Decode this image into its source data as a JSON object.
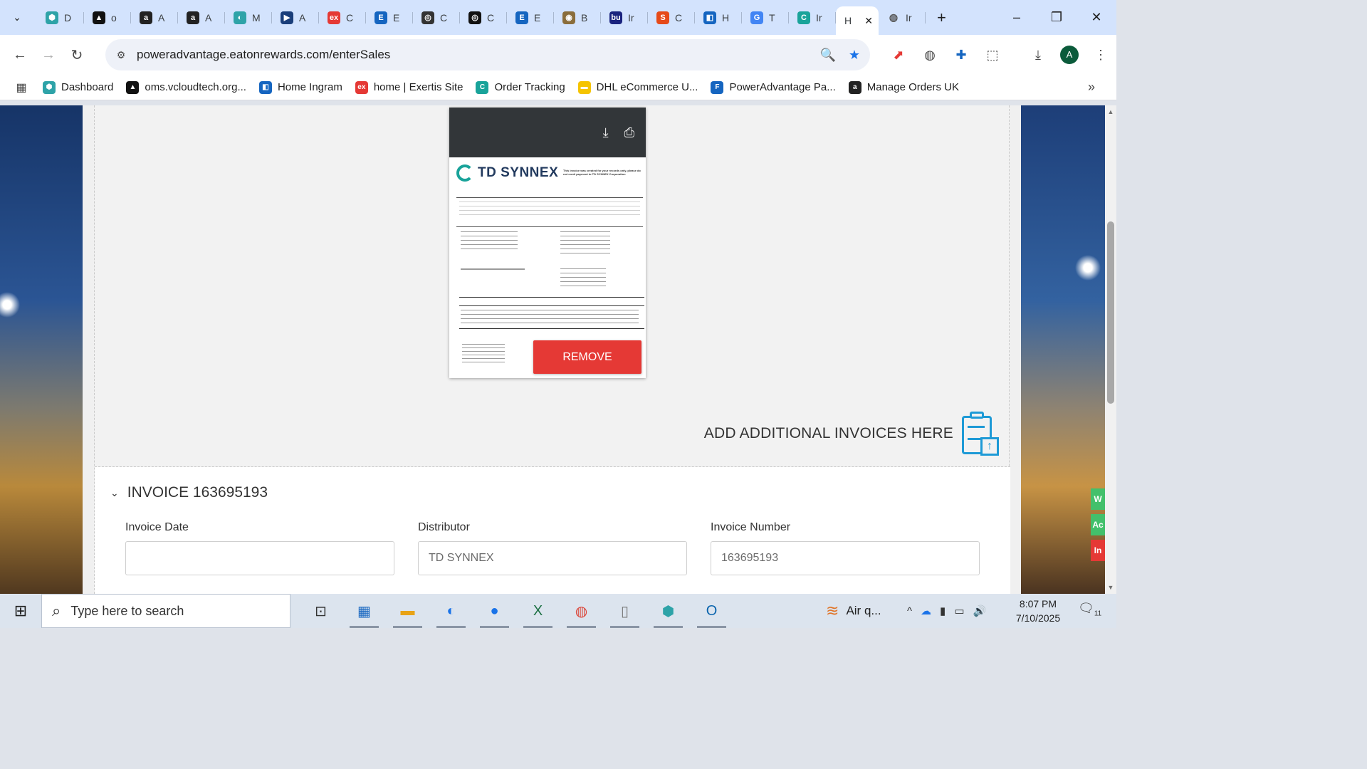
{
  "browser": {
    "tabs": [
      {
        "letter": "D",
        "color": "#2ea3a8",
        "glyph": "⬢"
      },
      {
        "letter": "o",
        "color": "#111111",
        "glyph": "▲"
      },
      {
        "letter": "A",
        "color": "#222222",
        "glyph": "a"
      },
      {
        "letter": "A",
        "color": "#222222",
        "glyph": "a"
      },
      {
        "letter": "M",
        "color": "#2ea3a8",
        "glyph": "◐"
      },
      {
        "letter": "A",
        "color": "#1a3e7a",
        "glyph": "▶"
      },
      {
        "letter": "C",
        "color": "#e53935",
        "glyph": "ex"
      },
      {
        "letter": "E",
        "color": "#1565c0",
        "glyph": "E"
      },
      {
        "letter": "C",
        "color": "#333333",
        "glyph": "◎"
      },
      {
        "letter": "C",
        "color": "#111111",
        "glyph": "◎"
      },
      {
        "letter": "E",
        "color": "#1565c0",
        "glyph": "E"
      },
      {
        "letter": "B",
        "color": "#8a6d3b",
        "glyph": "◉"
      },
      {
        "letter": "Ir",
        "color": "#1a237e",
        "glyph": "bu"
      },
      {
        "letter": "C",
        "color": "#e64a19",
        "glyph": "S"
      },
      {
        "letter": "H",
        "color": "#1565c0",
        "glyph": "◧"
      },
      {
        "letter": "T",
        "color": "#4285f4",
        "glyph": "G"
      },
      {
        "letter": "Ir",
        "color": "#19a39a",
        "glyph": "C"
      }
    ],
    "active_tab": {
      "letter": "H",
      "close": "✕"
    },
    "last_tab": {
      "letter": "Ir",
      "glyph": "◍"
    },
    "new_tab": "+",
    "window_controls": {
      "minimize": "–",
      "restore": "❐",
      "close": "✕"
    },
    "nav": {
      "back": "←",
      "forward": "→",
      "reload": "↻",
      "site_info": "⚙"
    },
    "url": "poweradvantage.eatonrewards.com/enterSales",
    "omni_icons": {
      "zoom": "🔍",
      "star": "★"
    },
    "extensions": [
      "⬈",
      "◍",
      "✚",
      "⬚",
      "⤓"
    ],
    "profile_initial": "A",
    "menu": "⋮",
    "tab_menu": "⌄",
    "bookmarks_apps": "▦",
    "bookmarks": [
      {
        "label": "Dashboard",
        "color": "#2ea3a8",
        "glyph": "⬢"
      },
      {
        "label": "oms.vcloudtech.org...",
        "color": "#111111",
        "glyph": "▲"
      },
      {
        "label": "Home Ingram",
        "color": "#1565c0",
        "glyph": "◧"
      },
      {
        "label": "home | Exertis Site",
        "color": "#e53935",
        "glyph": "ex"
      },
      {
        "label": "Order Tracking",
        "color": "#19a39a",
        "glyph": "C"
      },
      {
        "label": "DHL eCommerce U...",
        "color": "#f5c400",
        "glyph": "▬"
      },
      {
        "label": "PowerAdvantage Pa...",
        "color": "#1565c0",
        "glyph": "F"
      },
      {
        "label": "Manage Orders UK",
        "color": "#222222",
        "glyph": "a"
      }
    ],
    "bookmarks_more": "»"
  },
  "preview": {
    "download_icon": "⤓",
    "print_icon": "⎙",
    "logo": "TD SYNNEX",
    "note": "This invoice was created for your records only, please do not remit payment to TD SYNNEX Corporation",
    "remove_label": "REMOVE"
  },
  "upload": {
    "add_label": "ADD ADDITIONAL INVOICES HERE",
    "upload_arrow": "↑"
  },
  "invoice": {
    "chevron": "⌄",
    "title": "INVOICE 163695193",
    "fields": {
      "date_label": "Invoice Date",
      "date_value": "",
      "distributor_label": "Distributor",
      "distributor_value": "TD SYNNEX",
      "number_label": "Invoice Number",
      "number_value": "163695193"
    }
  },
  "side_tabs": [
    {
      "label": "W",
      "color": "#43c06b"
    },
    {
      "label": "Ac",
      "color": "#43c06b"
    },
    {
      "label": "In",
      "color": "#e53935"
    }
  ],
  "taskbar": {
    "start": "⊞",
    "search_icon": "⌕",
    "search_placeholder": "Type here to search",
    "apps": [
      "⊡",
      "▦",
      "▬",
      "◐",
      "●",
      "X",
      "◍",
      "▯",
      "⬢",
      "O"
    ],
    "weather": "Air q...",
    "weather_icon": "≋",
    "tray": [
      "^",
      "☁",
      "▮",
      "▭",
      "🔊"
    ],
    "time": "8:07 PM",
    "date": "7/10/2025",
    "notifications": "11"
  }
}
